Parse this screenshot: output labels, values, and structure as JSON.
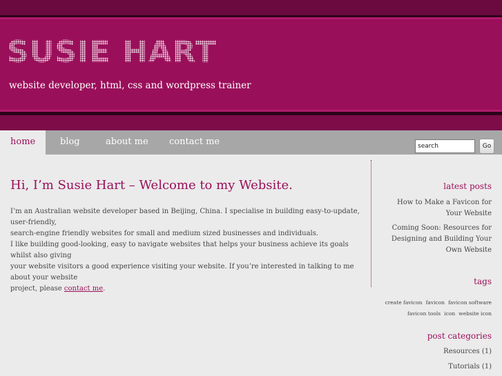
{
  "header": {
    "title": "SUSIE HART",
    "tagline": "website developer, html, css and wordpress trainer"
  },
  "nav": {
    "items": [
      "home",
      "blog",
      "about me",
      "contact me"
    ],
    "active": "home",
    "search_value": "search",
    "go_label": "Go"
  },
  "main": {
    "title": "Hi, I’m Susie Hart – Welcome to my Website.",
    "paragraph1_line1": "I’m an Australian website developer based in Beijing, China. I specialise in building easy-to-update, user-friendly,",
    "paragraph1_line2": "search-engine friendly websites for small and medium sized businesses and individuals.",
    "paragraph2_line1": "I like building good-looking, easy to navigate websites that helps your business achieve its goals whilst also giving",
    "paragraph2_line2": "your website visitors a good experience visiting your website. If you’re interested in talking to me about your website",
    "paragraph2_line3_prefix": "project, please ",
    "contact_link": "contact me",
    "paragraph2_line3_suffix": "."
  },
  "sidebar": {
    "latest_posts_heading": "latest posts",
    "post1_line1": "How to Make a Favicon for",
    "post1_line2": "Your Website",
    "post2_line1": "Coming Soon: Resources for",
    "post2_line2": "Designing and Building Your",
    "post2_line3": "Own Website",
    "tags_heading": "tags",
    "tags_row1": [
      "create favicon",
      "favicon",
      "favicon software"
    ],
    "tags_row2": [
      "favicon tools",
      "icon",
      "website icon"
    ],
    "categories_heading": "post categories",
    "categories": [
      "Resources (1)",
      "Tutorials (1)"
    ]
  },
  "colors": {
    "brand": "#9a0f5a",
    "nav_bg": "#a7a7a7",
    "page_bg": "#ebebeb"
  }
}
